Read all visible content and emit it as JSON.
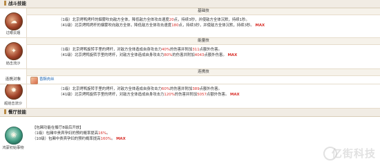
{
  "sections": {
    "battle_title": "战斗技能",
    "restaurant_title": "餐厅技能"
  },
  "skills": [
    {
      "name": "过眼云烟",
      "type": "基础技",
      "lines": [
        {
          "pre": "（1级）北京烤鸭烤杆的烟雾吹向敌方全体，降低敌方全体攻击速度",
          "val": "20",
          "post": "点，持续3秒，并使敌方全体沉默，持续1秒。",
          "max": ""
        },
        {
          "pre": "（41级）北京烤鸭烤杆的烟雾吹向敌方全体，降低敌方全体攻击速度",
          "val": "180",
          "post": "点，持续3秒，并使敌方全体沉默，持续3秒。",
          "max": "MAX"
        }
      ]
    },
    {
      "name": "焰击流沙",
      "type": "能量技",
      "lines": [
        {
          "pre": "（1级）北京烤鸭旋转手里的烤杆，对敌方全体造成自身攻击力",
          "val": "40%",
          "mid": "的伤害并附加",
          "val2": "311",
          "post": "点额外伤害。",
          "max": ""
        },
        {
          "pre": "（41级）北京烤鸭旋转手里的烤杆，对敌方全体造成自身攻击力",
          "val": "80%",
          "mid": "的伤害并附加",
          "val2": "4043",
          "post": "点额外伤害。",
          "max": "MAX"
        }
      ]
    },
    {
      "name": "超焰击流沙",
      "type": "连携技",
      "combo_label": "连携对象",
      "combo_partner": "香酥肉丝",
      "lines": [
        {
          "pre": "（1级）北京烤鸭旋转手里的烤杆，对敌方全体造成自身攻击力",
          "val": "60%",
          "mid": "的伤害并附加",
          "val2": "389",
          "post": "点额外伤害。",
          "max": ""
        },
        {
          "pre": "（41级）北京烤鸭旋转手里的烤杆，对敌方全体造成自身攻击力",
          "val": "120%",
          "mid": "的伤害并附加",
          "val2": "5057",
          "post": "点额外伤害。",
          "max": "MAX"
        }
      ]
    }
  ],
  "restaurant_skill": {
    "name": "鸿蒙初始事物",
    "header": "【包厢功能在餐厅8级后开放】",
    "lines": [
      {
        "pre": "（1级）包厢中贵宾孕妇的预约概率提高",
        "val": "16%",
        "post": "。",
        "max": ""
      },
      {
        "pre": "（10级）包厢中贵宾孕妇的预约概率提高",
        "val": "160%",
        "post": "。",
        "max": "MAX"
      }
    ]
  },
  "watermark": "亿街科技"
}
